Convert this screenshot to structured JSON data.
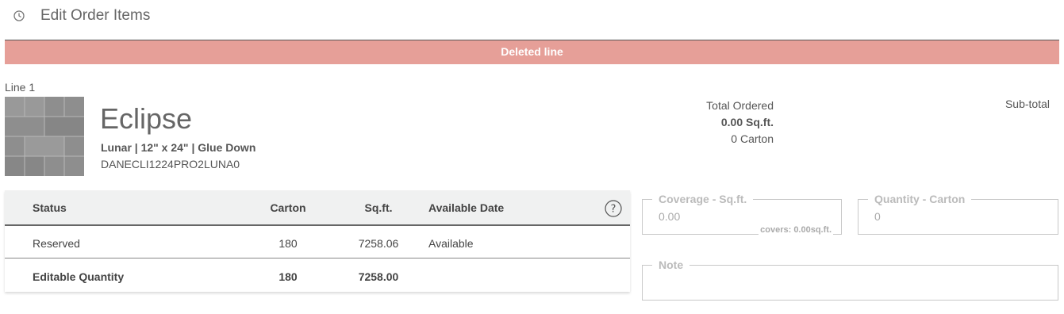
{
  "header": {
    "title": "Edit Order Items",
    "icon": "clock-icon"
  },
  "banner": {
    "text": "Deleted line",
    "color": "#e69f98"
  },
  "line": {
    "label": "Line 1",
    "product_name": "Eclipse",
    "description": "Lunar | 12\" x 24\" | Glue Down",
    "sku": "DANECLI1224PRO2LUNA0"
  },
  "totals": {
    "title": "Total Ordered",
    "sqft": "0.00 Sq.ft.",
    "carton": "0 Carton",
    "subtotal_label": "Sub-total"
  },
  "table": {
    "columns": [
      "Status",
      "Carton",
      "Sq.ft.",
      "Available Date"
    ],
    "rows": [
      {
        "status": "Reserved",
        "carton": "180",
        "sqft": "7258.06",
        "available": "Available"
      },
      {
        "status": "Editable Quantity",
        "carton": "180",
        "sqft": "7258.00",
        "available": ""
      }
    ]
  },
  "fields": {
    "coverage": {
      "label": "Coverage - Sq.ft.",
      "placeholder": "0.00",
      "hint": "covers: 0.00sq.ft."
    },
    "quantity": {
      "label": "Quantity - Carton",
      "placeholder": "0"
    },
    "note": {
      "label": "Note",
      "placeholder": ""
    }
  }
}
